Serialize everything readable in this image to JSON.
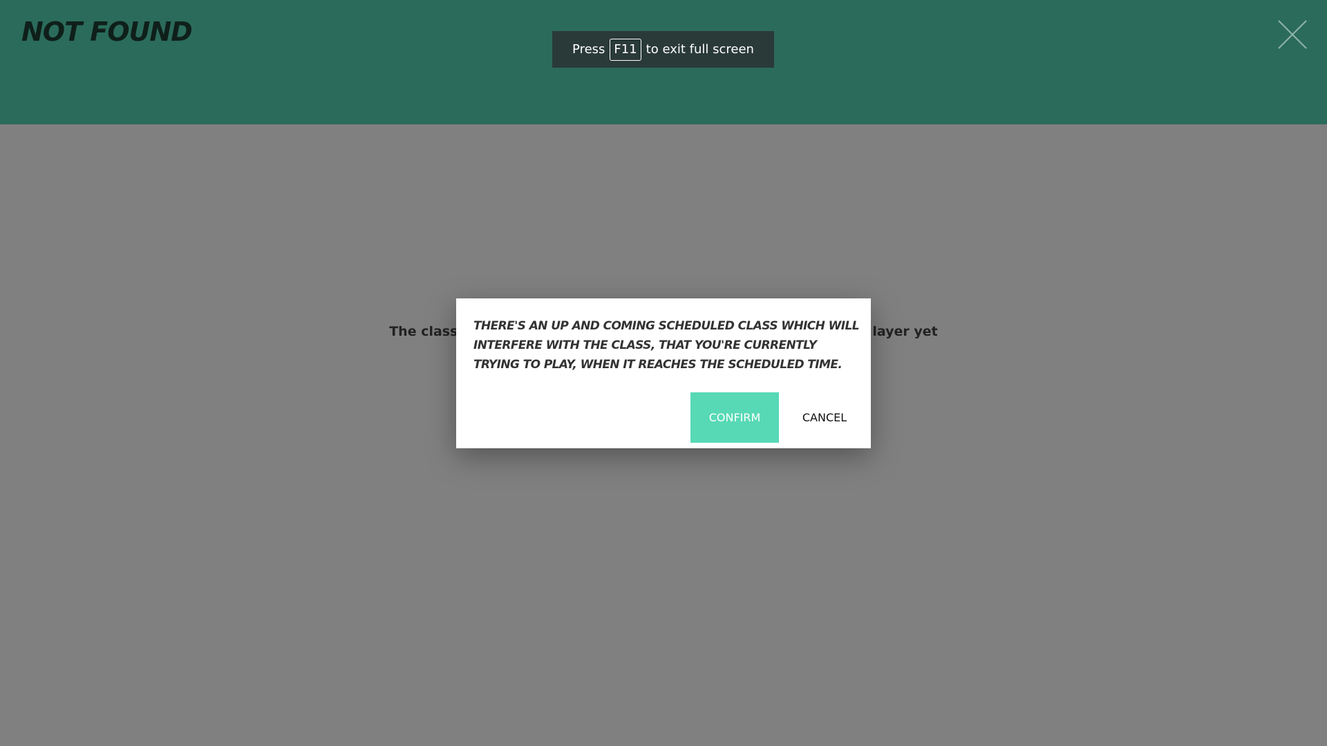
{
  "header": {
    "title": "NOT FOUND",
    "close_icon": "close-icon"
  },
  "fullscreen_notice": {
    "prefix": "Press",
    "key": "F11",
    "suffix": "to exit full screen"
  },
  "background": {
    "message_start": "The class",
    "message_end": "layer yet"
  },
  "dialog": {
    "message": "THERE'S AN UP AND COMING SCHEDULED CLASS WHICH WILL INTERFERE WITH THE CLASS, THAT YOU'RE CURRENTLY TRYING TO PLAY, WHEN IT REACHES THE SCHEDULED TIME.",
    "confirm_label": "CONFIRM",
    "cancel_label": "CANCEL"
  },
  "colors": {
    "header_bg": "#2b6b5b",
    "overlay_bg": "#808080",
    "confirm_bg": "#57d9b5"
  }
}
